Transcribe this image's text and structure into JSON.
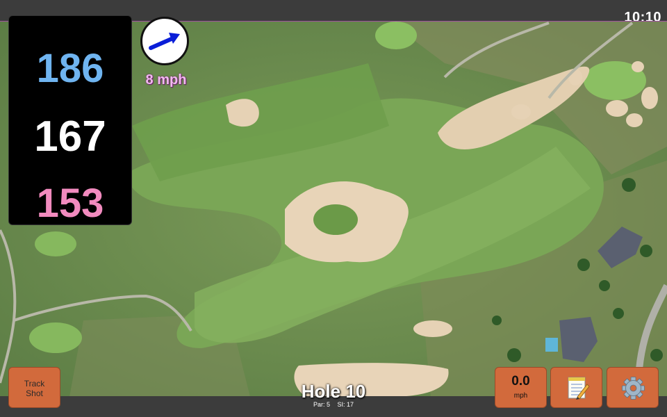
{
  "status": {
    "clock": "10:10"
  },
  "distances": {
    "back": "186",
    "middle": "167",
    "front": "153"
  },
  "wind": {
    "speed": "8 mph",
    "icon": "arrow-right-icon"
  },
  "hole": {
    "title": "Hole 10",
    "par": "Par: 5",
    "stroke_index": "SI: 17"
  },
  "buttons": {
    "track_shot": "Track\nShot",
    "speed_value": "0.0",
    "speed_unit": "mph",
    "notes_icon": "notepad-icon",
    "settings_icon": "gear-icon"
  },
  "colors": {
    "back": "#6fb4f0",
    "middle": "#ffffff",
    "front": "#f28bbf",
    "button": "#d26a3c",
    "wind_text": "#f2b8f0"
  }
}
